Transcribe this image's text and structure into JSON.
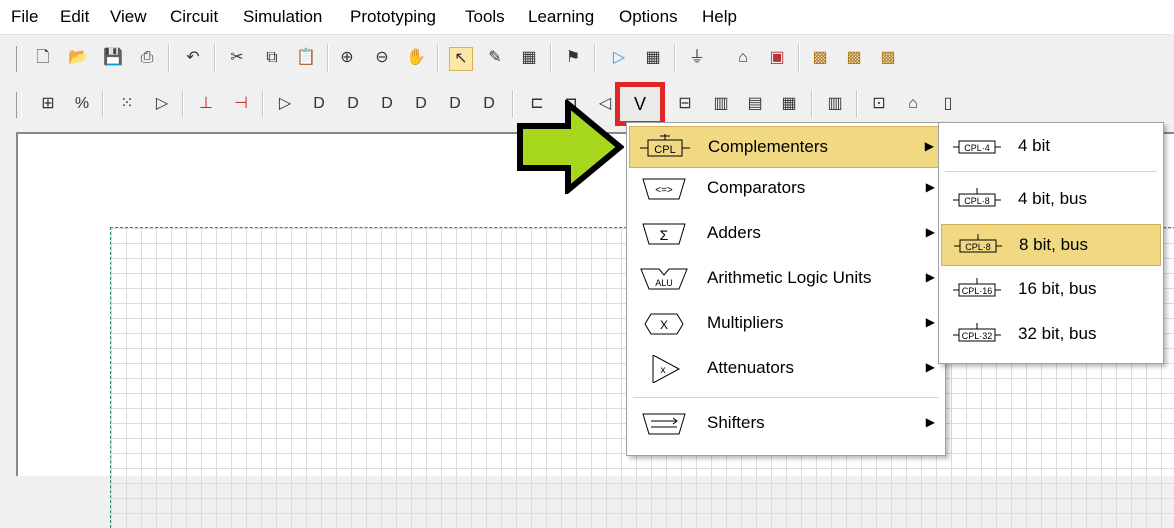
{
  "menubar": {
    "items": [
      "File",
      "Edit",
      "View",
      "Circuit",
      "Simulation",
      "Prototyping",
      "Tools",
      "Learning",
      "Options",
      "Help"
    ]
  },
  "highlight": {
    "glyph": "V"
  },
  "menu": {
    "items": [
      {
        "label": "Complementers",
        "selected": true
      },
      {
        "label": "Comparators",
        "selected": false
      },
      {
        "label": "Adders",
        "selected": false
      },
      {
        "label": "Arithmetic Logic Units",
        "selected": false
      },
      {
        "label": "Multipliers",
        "selected": false
      },
      {
        "label": "Attenuators",
        "selected": false
      },
      {
        "label": "Shifters",
        "selected": false
      }
    ]
  },
  "submenu": {
    "items": [
      {
        "label": "4 bit",
        "icon_text": "CPL·4",
        "selected": false
      },
      {
        "label": "4 bit, bus",
        "icon_text": "CPL·8",
        "selected": false
      },
      {
        "label": "8 bit, bus",
        "icon_text": "CPL·8",
        "selected": true
      },
      {
        "label": "16 bit, bus",
        "icon_text": "CPL·16",
        "selected": false
      },
      {
        "label": "32 bit, bus",
        "icon_text": "CPL·32",
        "selected": false
      }
    ]
  },
  "icons": {
    "cpl": "CPL",
    "cmp": "<=>",
    "add": "Σ",
    "alu": "ALU",
    "mul": "X",
    "att": "x"
  },
  "colors": {
    "highlight_border": "#e12626",
    "arrow_fill": "#a8d81e",
    "menu_selection": "#f1d883"
  }
}
